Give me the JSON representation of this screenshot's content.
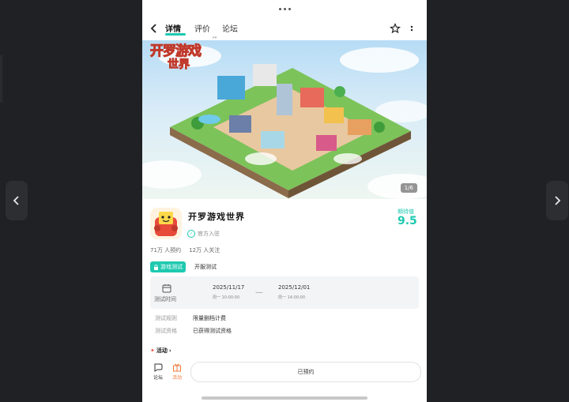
{
  "tabs": [
    {
      "label": "详情",
      "active": true
    },
    {
      "label": "评价",
      "active": false
    },
    {
      "label": "论坛",
      "active": false
    }
  ],
  "tab_badge": "\"\"",
  "banner": {
    "logo_line1": "开罗游戏",
    "logo_line2": "世界",
    "page_indicator": "1/6"
  },
  "game": {
    "title": "开罗游戏世界",
    "official": "官方入驻",
    "score_label": "期待值",
    "score": "9.5",
    "reservations": "71万 人预约",
    "followers": "12万 人关注"
  },
  "test": {
    "badge": "游戏测试",
    "type": "开服测试",
    "time_label": "测试时间",
    "start_date": "2025/11/17",
    "start_detail": "周一 10:00:00",
    "end_date": "2025/12/01",
    "end_detail": "周一 14:00:00",
    "rules": [
      {
        "key": "测试规则",
        "value": "限量删档计费"
      },
      {
        "key": "测试资格",
        "value": "已获得测试资格"
      }
    ]
  },
  "activity_label": "活动",
  "bottom": {
    "forum_label": "论坛",
    "activity_label": "活动",
    "reserve_label": "已预约"
  },
  "colors": {
    "accent": "#1ec9b0",
    "gift": "#f07a3a"
  },
  "icons": [
    "chevron-left-icon",
    "chevron-right-icon",
    "back-arrow-icon",
    "star-outline-icon",
    "more-vertical-icon",
    "verified-icon",
    "calendar-icon",
    "chat-icon",
    "gift-icon",
    "lock-icon",
    "pin-icon"
  ]
}
